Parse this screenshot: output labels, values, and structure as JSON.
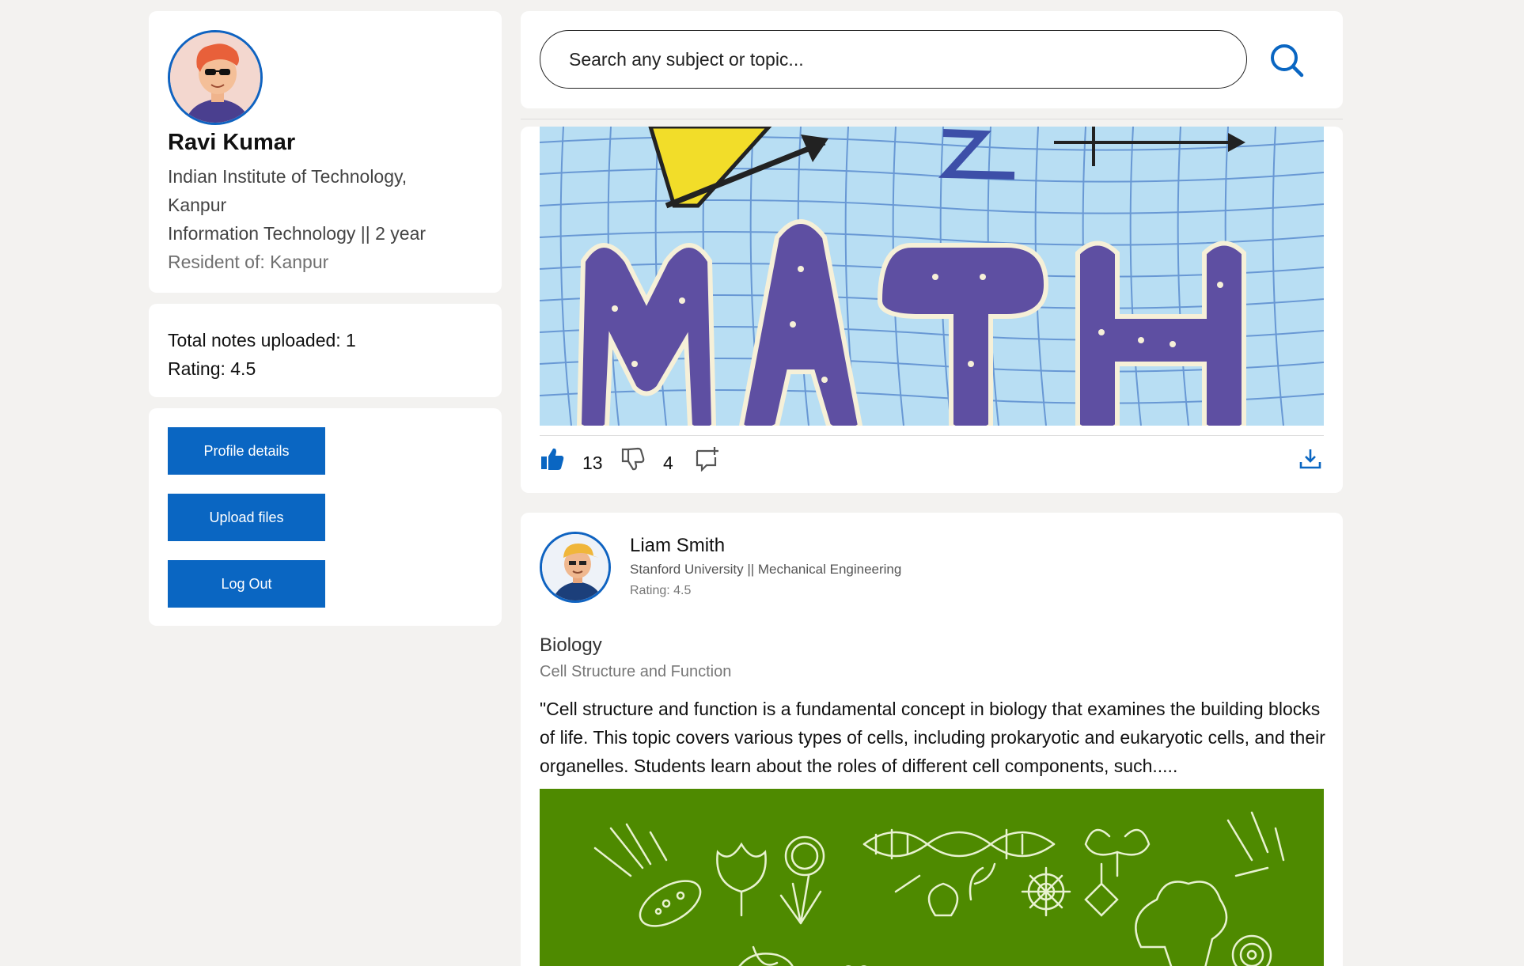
{
  "profile": {
    "name": "Ravi Kumar",
    "institution_line1": "Indian Institute of Technology,",
    "institution_line2": "Kanpur",
    "program": "Information Technology || 2 year",
    "resident": "Resident of: Kanpur"
  },
  "stats": {
    "notes": "Total notes uploaded: 1",
    "rating": "Rating: 4.5"
  },
  "actions": {
    "profile_details": "Profile details",
    "upload_files": "Upload files",
    "log_out": "Log Out"
  },
  "search": {
    "placeholder": "Search any subject or topic..."
  },
  "post1": {
    "likes": "13",
    "dislikes": "4"
  },
  "post2": {
    "author_name": "Liam Smith",
    "author_meta": "Stanford University || Mechanical Engineering",
    "author_rating": "Rating: 4.5",
    "subject": "Biology",
    "topic": "Cell Structure and Function",
    "body": "\"Cell structure and function is a fundamental concept in biology that examines the building blocks of life. This topic covers various types of cells, including prokaryotic and eukaryotic cells, and their organelles. Students learn about the roles of different cell components, such....."
  },
  "icons": {
    "search": "search-icon",
    "like": "thumbs-up-icon",
    "dislike": "thumbs-down-icon",
    "comment": "comment-add-icon",
    "download": "download-icon"
  },
  "colors": {
    "primary": "#0a66c2",
    "page_bg": "#f3f2f0",
    "card_bg": "#ffffff"
  }
}
